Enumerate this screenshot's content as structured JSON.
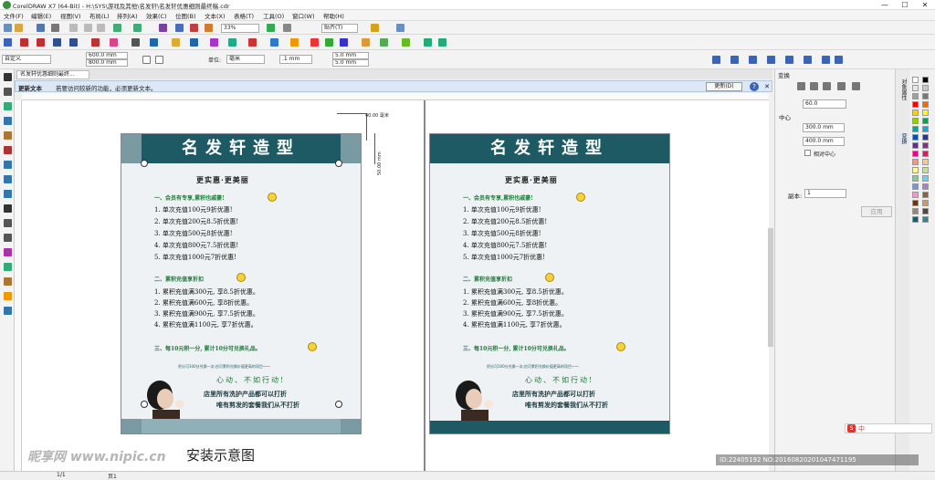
{
  "window": {
    "title": "CorelDRAW X7 (64-Bit) - H:\\SYS\\游戏及其他\\名发轩\\名发轩优惠细则最终稿.cdr",
    "min": "—",
    "max": "☐",
    "close": "✕"
  },
  "menu": [
    "文件(F)",
    "编辑(E)",
    "视图(V)",
    "布局(L)",
    "排列(A)",
    "效果(C)",
    "位图(B)",
    "文本(X)",
    "表格(T)",
    "工具(O)",
    "窗口(W)",
    "帮助(H)"
  ],
  "toolbar1": {
    "zoom": "33%",
    "snap": "贴齐(T)"
  },
  "propbar": {
    "preset": "自定义",
    "width": "600.0 mm",
    "height": "800.0 mm",
    "unit_label": "单位:",
    "unit": "毫米",
    "nudge": ".1 mm",
    "dup_x": "5.0 mm",
    "dup_y": "5.0 mm"
  },
  "doctab": "名发轩优惠细则最终...",
  "notification": {
    "title": "更新文本",
    "message": "若要访问较新的功能，必须更新文本。",
    "button": "更新(D)",
    "help": "?"
  },
  "dimension": {
    "top": "40.00 毫米",
    "side": "50.00 mm"
  },
  "card": {
    "brand": "名发轩造型",
    "subtitle": "更实惠·更美丽",
    "sec1": "一、会员有专享,累积也戚豪!",
    "items1": [
      "1. 单次充值100元9折优惠!",
      "2. 单次充值200元8.5折优惠!",
      "3. 单次充值500元8折优惠!",
      "4. 单次充值800元7.5折优惠!",
      "5. 单次充值1000元7折优惠!"
    ],
    "sec2": "二、累积充值享折扣",
    "items2": [
      "1. 累积充值满300元, 享8.5折优惠。",
      "2. 累积充值满600元, 享8折优惠。",
      "3. 累积充值满900元, 享7.5折优惠。",
      "4. 累积充值满1100元, 享7折优惠。"
    ],
    "sec3": "三、每10元积一分, 累计10分可兑换礼品。",
    "points_note": "积分可100分兑换一次,也可累积兑换价值更高的项目～～",
    "action": "心动、不如行动!",
    "slogan1": "店里所有洗护产品都可以打折",
    "slogan2": "唯有剪发的套餐我们从不打折"
  },
  "caption": "安装示意图",
  "docker": {
    "title": "变换",
    "x": "300.0 mm",
    "y": "400.0 mm",
    "center": "中心",
    "rel": "相对中心",
    "copies_label": "副本:",
    "copies": "1",
    "apply": "应用",
    "angle": "60.0"
  },
  "dockertabs": [
    "对象属性",
    "变换"
  ],
  "statusbar": {
    "page": "1/1",
    "page_tab": "页1"
  },
  "watermark": {
    "logo": "昵享网 www.nipic.cn",
    "id": "ID:22405192 NO:20160820201047471195"
  },
  "ime": "中",
  "palette": [
    "#ffffff",
    "#000000",
    "#e6e6e6",
    "#c8c8c8",
    "#a0a0a0",
    "#787878",
    "#ff0000",
    "#ff6600",
    "#ffcc00",
    "#ffff00",
    "#99cc00",
    "#00a650",
    "#00a99d",
    "#00aeef",
    "#0054a6",
    "#2e3192",
    "#662d91",
    "#92278f",
    "#ec008c",
    "#ed145b",
    "#f7977a",
    "#fdc68a",
    "#fff79a",
    "#c4df9b",
    "#82ca9d",
    "#6dcff6",
    "#8393ca",
    "#a186be",
    "#f49ac1",
    "#8c6239",
    "#603913",
    "#c69c6d",
    "#998675",
    "#534741",
    "#1d5a63",
    "#3d7f8a"
  ]
}
